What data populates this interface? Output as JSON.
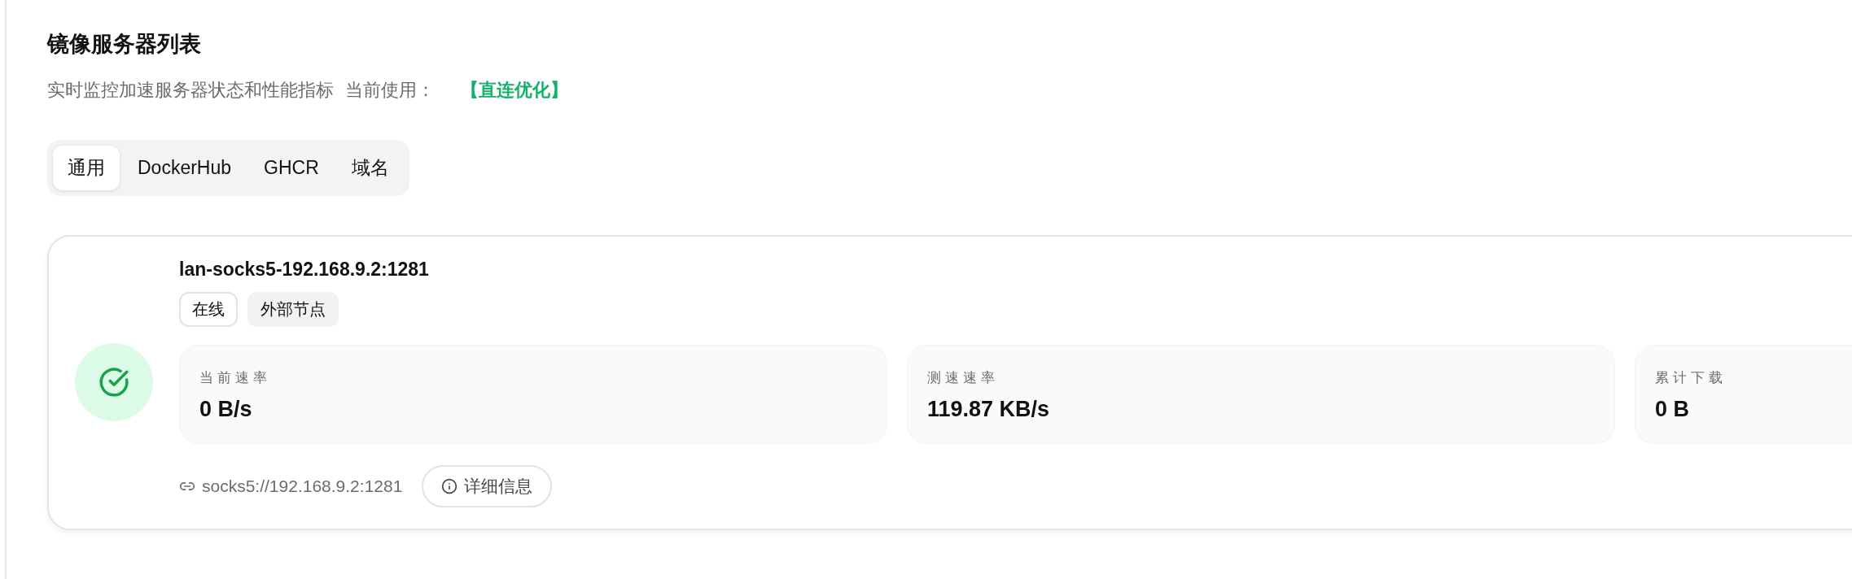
{
  "title": "镜像服务器列表",
  "subtitle": {
    "text": "实时监控加速服务器状态和性能指标",
    "current_label": "当前使用：",
    "current_value": "【直连优化】"
  },
  "tabs": [
    {
      "label": "通用",
      "selected": true
    },
    {
      "label": "DockerHub",
      "selected": false
    },
    {
      "label": "GHCR",
      "selected": false
    },
    {
      "label": "域名",
      "selected": false
    }
  ],
  "servers": [
    {
      "name": "lan-socks5-192.168.9.2:1281",
      "online": true,
      "tags": [
        {
          "label": "在线",
          "kind": "outline"
        },
        {
          "label": "外部节点",
          "kind": "filled"
        }
      ],
      "stats": [
        {
          "label": "当前速率",
          "value": "0 B/s"
        },
        {
          "label": "测速速率",
          "value": "119.87 KB/s"
        },
        {
          "label": "累计下载",
          "value": "0 B"
        }
      ],
      "address": "socks5://192.168.9.2:1281",
      "details_button": "详细信息"
    }
  ]
}
